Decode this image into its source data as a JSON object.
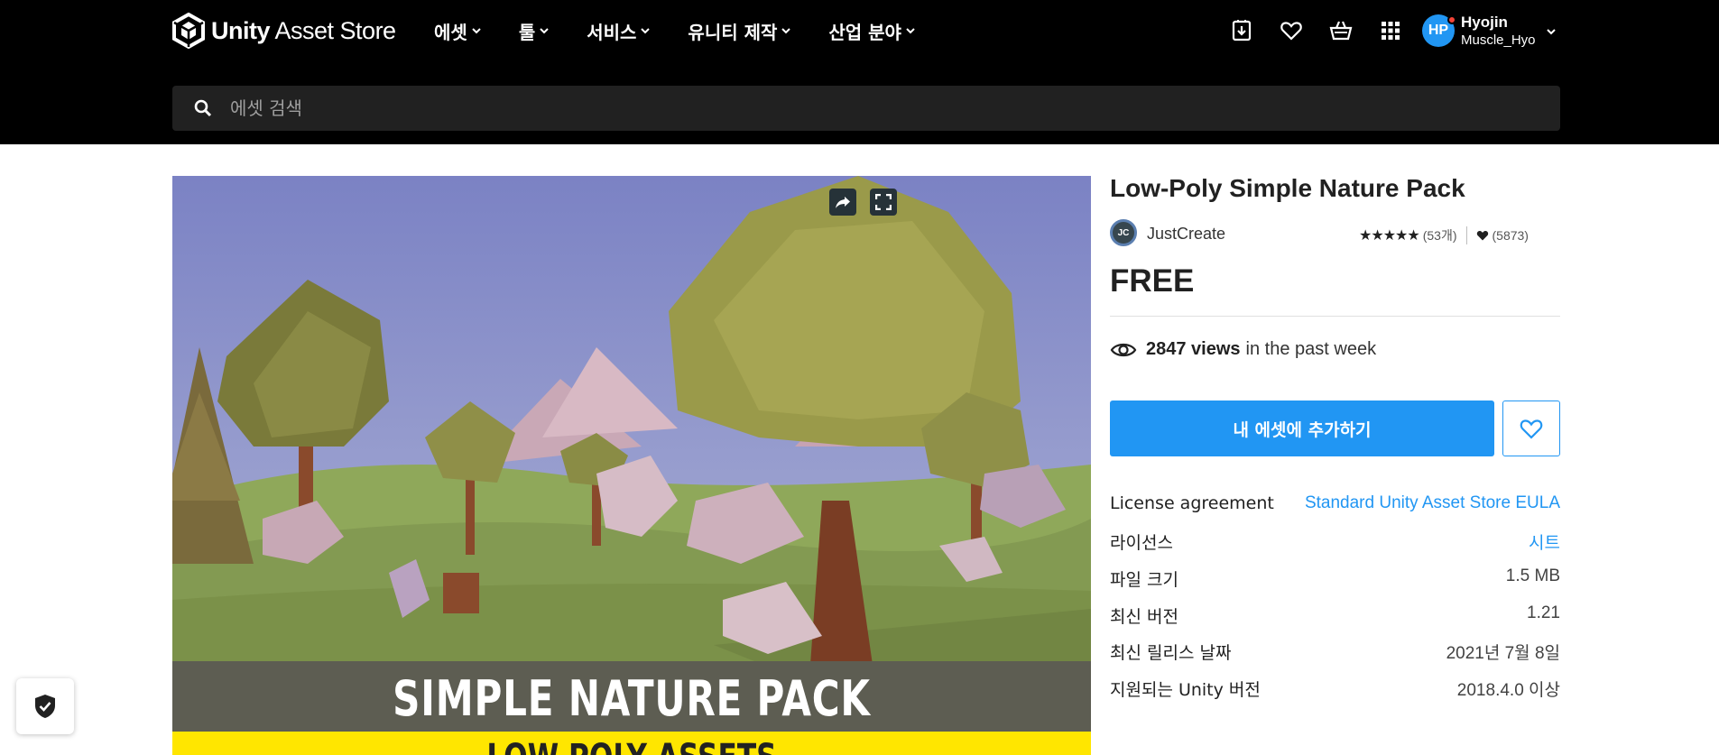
{
  "header": {
    "logo_bold": "Unity",
    "logo_text": "Asset Store",
    "nav": [
      "에셋",
      "툴",
      "서비스",
      "유니티 제작",
      "산업 분야"
    ],
    "user": {
      "initials": "HP",
      "name": "Hyojin",
      "handle": "Muscle_Hyo"
    },
    "search_placeholder": "에셋 검색",
    "icons": [
      "download-icon",
      "heart-icon",
      "cart-icon",
      "apps-grid-icon"
    ]
  },
  "hero": {
    "banner_title": "SIMPLE NATURE PACK",
    "banner_subtitle": "LOW POLY ASSETS"
  },
  "product": {
    "title": "Low-Poly Simple Nature Pack",
    "publisher_initials": "JC",
    "publisher": "JustCreate",
    "stars": "★★★★★",
    "review_count": "(53개)",
    "favorites": "(5873)",
    "price": "FREE",
    "views_count": "2847 views",
    "views_suffix": "in the past week",
    "add_button": "내 에셋에 추가하기"
  },
  "details": [
    {
      "label": "License agreement",
      "value": "Standard Unity Asset Store EULA",
      "link": true
    },
    {
      "label": "라이선스",
      "value": "시트",
      "link": true
    },
    {
      "label": "파일 크기",
      "value": "1.5 MB",
      "link": false
    },
    {
      "label": "최신 버전",
      "value": "1.21",
      "link": false
    },
    {
      "label": "최신 릴리스 날짜",
      "value": "2021년 7월 8일",
      "link": false
    },
    {
      "label": "지원되는 Unity 버전",
      "value": "2018.4.0 이상",
      "link": false
    }
  ],
  "colors": {
    "accent": "#2196f3",
    "header_bg": "#000000",
    "banner_yellow": "#ffe600"
  }
}
